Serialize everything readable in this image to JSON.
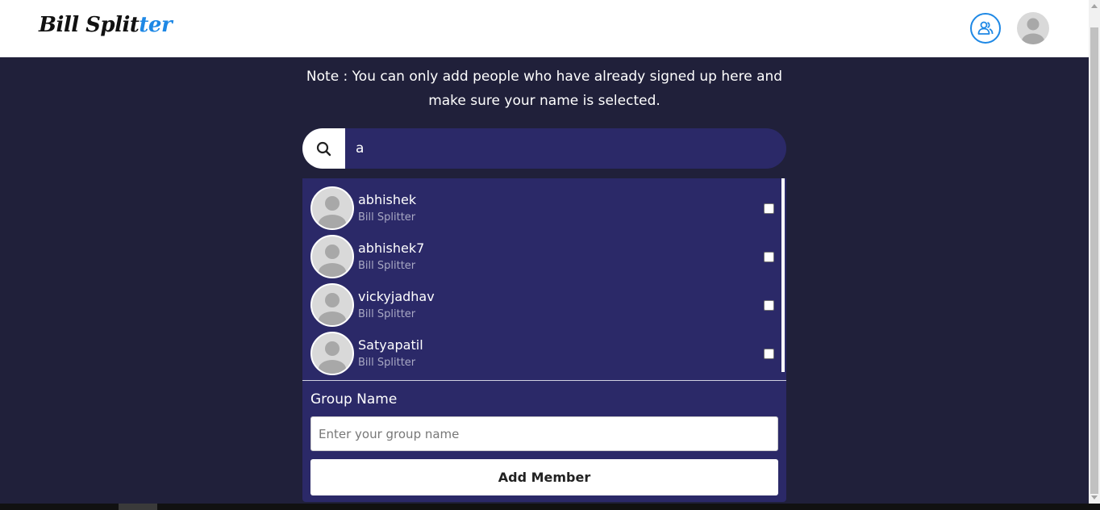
{
  "header": {
    "logo_main": "Bill Split",
    "logo_accent": "ter",
    "accent_color": "#1e88e5",
    "icons": [
      "users-icon",
      "avatar"
    ]
  },
  "note": "Note : You can only add people who have already signed up here and make sure your name is selected.",
  "search": {
    "value": "a",
    "icon": "search-icon"
  },
  "members": [
    {
      "name": "abhishek",
      "sub": "Bill Splitter",
      "checked": false
    },
    {
      "name": "abhishek7",
      "sub": "Bill Splitter",
      "checked": false
    },
    {
      "name": "vickyjadhav",
      "sub": "Bill Splitter",
      "checked": false
    },
    {
      "name": "Satyapatil",
      "sub": "Bill Splitter",
      "checked": false
    }
  ],
  "group": {
    "label": "Group Name",
    "placeholder": "Enter your group name",
    "value": ""
  },
  "add_button_label": "Add Member",
  "colors": {
    "page_bg": "#20203a",
    "panel_bg": "#2b2968",
    "header_bg": "#ffffff"
  }
}
